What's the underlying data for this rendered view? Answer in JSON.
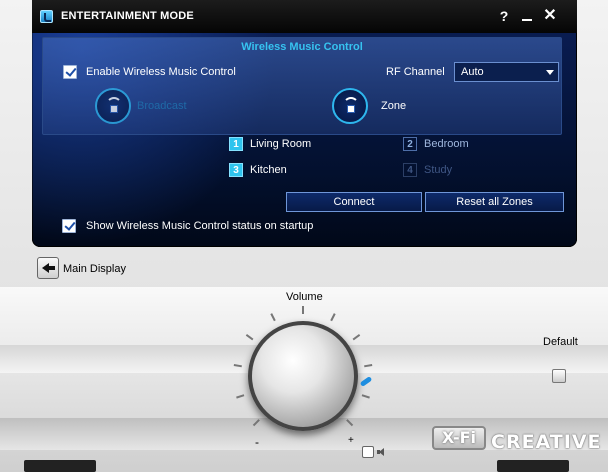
{
  "window": {
    "title": "ENTERTAINMENT MODE",
    "help_label": "?",
    "close_label": "✕"
  },
  "wireless_panel": {
    "title": "Wireless Music Control",
    "enable_label": "Enable Wireless Music Control",
    "enable_checked": true,
    "rf_channel_label": "RF Channel",
    "rf_channel_value": "Auto",
    "broadcast_label": "Broadcast",
    "zone_label": "Zone"
  },
  "zones": [
    {
      "number": "1",
      "name": "Living Room",
      "state": "active"
    },
    {
      "number": "2",
      "name": "Bedroom",
      "state": "inactive"
    },
    {
      "number": "3",
      "name": "Kitchen",
      "state": "active"
    },
    {
      "number": "4",
      "name": "Study",
      "state": "disabled"
    }
  ],
  "buttons": {
    "connect": "Connect",
    "reset_all_zones": "Reset all Zones"
  },
  "startup": {
    "label": "Show Wireless Music Control status on startup",
    "checked": true
  },
  "main_display": {
    "label": "Main Display"
  },
  "console": {
    "volume_label": "Volume",
    "minus_label": "-",
    "plus_label": "+",
    "default_label": "Default",
    "xfi_logo": "X-Fi",
    "creative_logo": "CREATIVE"
  },
  "icons": {
    "app": "music-note-icon",
    "broadcast": "broadcast-icon",
    "zone": "zone-icon",
    "back": "arrow-left-icon",
    "speaker": "speaker-icon"
  },
  "colors": {
    "accent": "#2fc4ee",
    "screen_bg": "#061640",
    "indicator": "#1e8ee0"
  }
}
